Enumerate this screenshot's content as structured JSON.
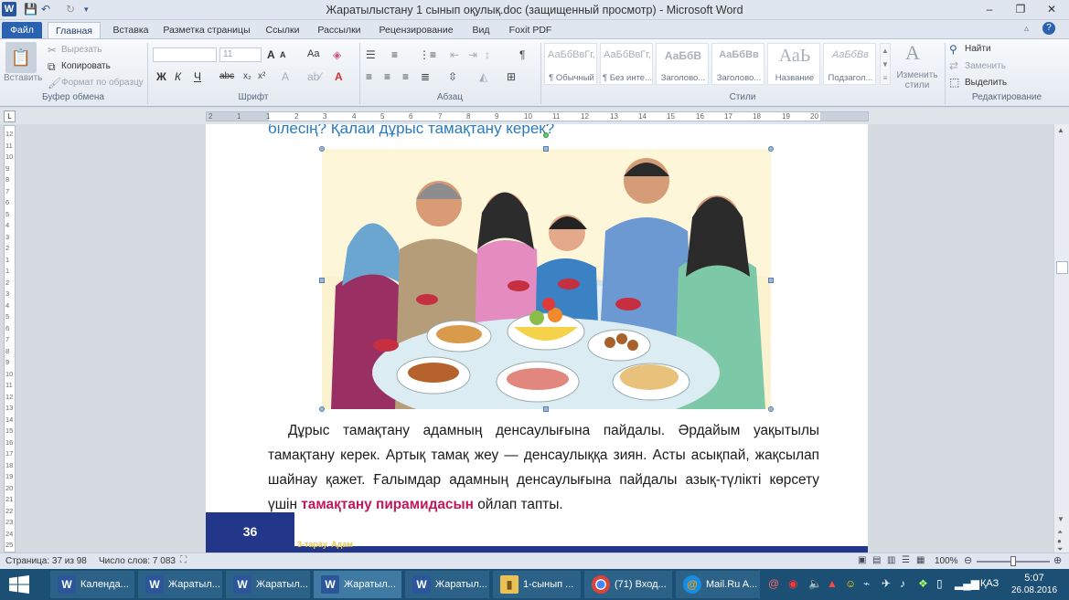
{
  "window": {
    "title": "Жаратылыстану 1 сынып оқулық.doc (защищенный просмотр) - Microsoft Word",
    "minimize": "‒",
    "restore": "❐",
    "close": "✕"
  },
  "tabs": [
    "Файл",
    "Главная",
    "Вставка",
    "Разметка страницы",
    "Ссылки",
    "Рассылки",
    "Рецензирование",
    "Вид",
    "Foxit PDF"
  ],
  "ribbon": {
    "clipboard": {
      "paste": "Вставить",
      "cut": "Вырезать",
      "copy": "Копировать",
      "format_painter": "Формат по образцу",
      "label": "Буфер обмена"
    },
    "font": {
      "size": "11",
      "bold": "Ж",
      "italic": "К",
      "underline": "Ч",
      "strike": "abc",
      "grow": "A",
      "shrink": "A",
      "case": "Aa",
      "label": "Шрифт"
    },
    "paragraph": {
      "label": "Абзац"
    },
    "styles": {
      "items": [
        {
          "preview": "АаБбВвГг,",
          "name": "¶ Обычный"
        },
        {
          "preview": "АаБбВвГг,",
          "name": "¶ Без инте..."
        },
        {
          "preview": "АаБбВ",
          "name": "Заголово..."
        },
        {
          "preview": "АаБбВв",
          "name": "Заголово..."
        },
        {
          "preview": "АаЬ",
          "name": "Название"
        },
        {
          "preview": "АаБбВв",
          "name": "Подзагол..."
        }
      ],
      "change": "Изменить стили",
      "label": "Стили"
    },
    "editing": {
      "find": "Найти",
      "replace": "Заменить",
      "select": "Выделить",
      "label": "Редактирование"
    }
  },
  "ruler": {
    "marks": [
      "2",
      "1",
      "1",
      "2",
      "3",
      "4",
      "5",
      "6",
      "7",
      "8",
      "9",
      "10",
      "11",
      "12",
      "13",
      "14",
      "15",
      "16",
      "17",
      "18",
      "19",
      "20"
    ]
  },
  "vruler": {
    "marks": [
      "12",
      "11",
      "10",
      "9",
      "8",
      "7",
      "6",
      "5",
      "4",
      "3",
      "2",
      "1",
      "1",
      "2",
      "3",
      "4",
      "5",
      "6",
      "7",
      "8",
      "9",
      "10",
      "11",
      "12",
      "13",
      "14",
      "15",
      "16",
      "17",
      "18",
      "19",
      "20",
      "21",
      "22",
      "23",
      "24",
      "25"
    ]
  },
  "document": {
    "heading": "білесің? Қалай дұрыс тамақтану керек?",
    "para_part1": "Дұрыс тамақтану адамның денсаулығына пайдалы. Әрдайым уақытылы тамақтану керек. Артық тамақ жеу — денсаулыққа зиян. Асты асықпай, жақсылап шайнау қажет. Ғалымдар адамның денсаулығына пайдалы азық-түлікті көрсету үшін ",
    "para_highlight": "тамақтану пирамидасын",
    "para_part2": " ойлап тапты.",
    "page_number": "36",
    "chapter": "3-тарау. Адам"
  },
  "status": {
    "page": "Страница: 37 из 98",
    "words": "Число слов: 7 083",
    "zoom": "100%"
  },
  "taskbar": {
    "items": [
      {
        "label": "Календа...",
        "icon": "word-icon"
      },
      {
        "label": "Жаратыл...",
        "icon": "word-icon"
      },
      {
        "label": "Жаратыл...",
        "icon": "word-icon"
      },
      {
        "label": "Жаратыл...",
        "icon": "word-icon"
      },
      {
        "label": "Жаратыл...",
        "icon": "word-icon"
      },
      {
        "label": "1-сынып ...",
        "icon": "folder-icon"
      },
      {
        "label": "(71) Вход...",
        "icon": "chrome-icon"
      },
      {
        "label": "Mail.Ru A...",
        "icon": "mailru-icon"
      }
    ],
    "lang": "ҚАЗ",
    "time": "5:07",
    "date": "26.08.2016"
  },
  "colors": {
    "accent": "#2b579a",
    "taskbar": "#1c4f74",
    "heading": "#2a7ac0",
    "highlight": "#c2185b",
    "footer": "#22368a"
  }
}
